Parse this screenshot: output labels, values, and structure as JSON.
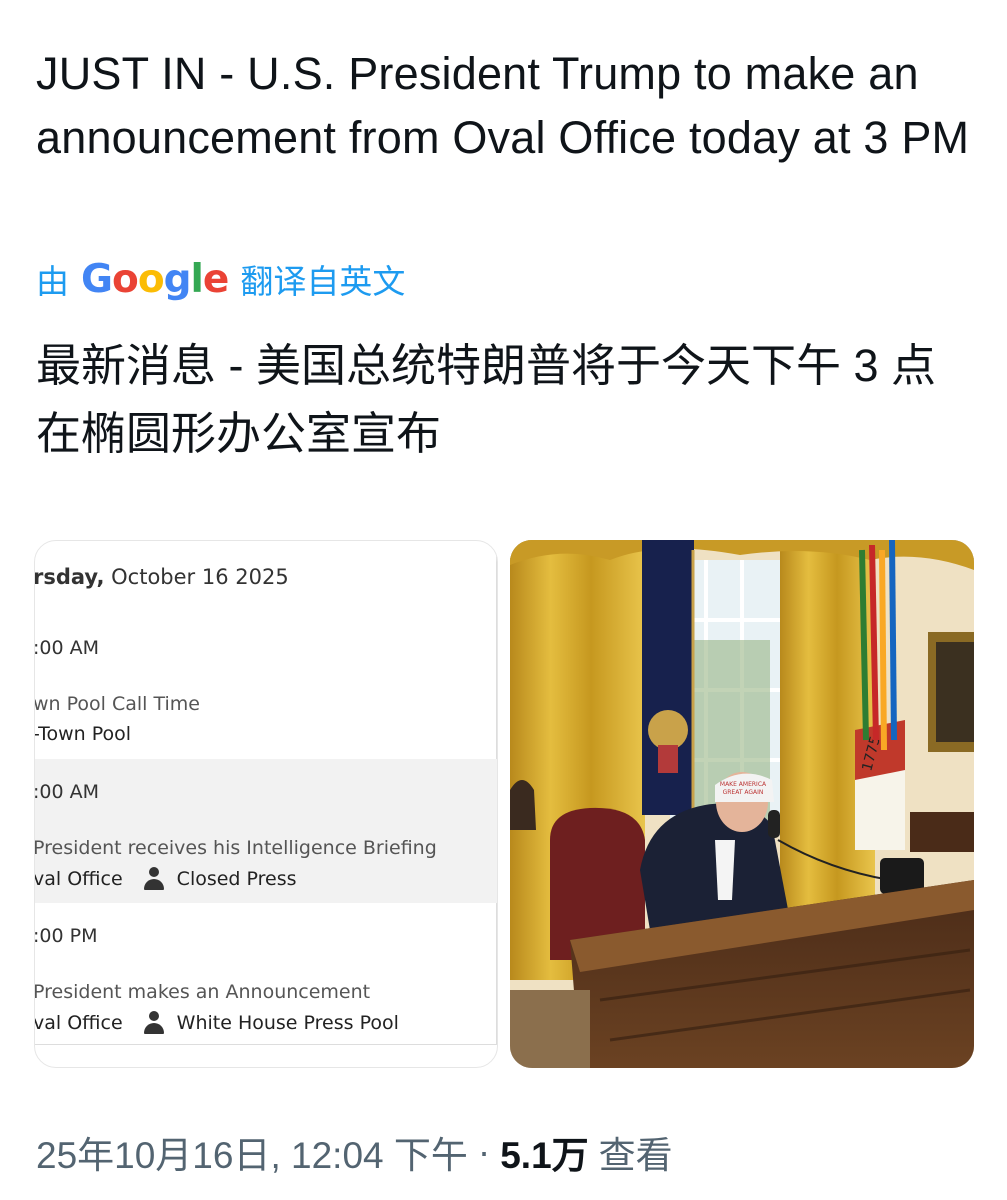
{
  "tweet": {
    "text": "JUST IN - U.S. President Trump to make an announcement from Oval Office today at 3 PM",
    "translate_by": "由",
    "translate_brand": "Google",
    "translate_suffix": "翻译自英文",
    "translated_text": "最新消息 - 美国总统特朗普将于今天下午 3 点在椭圆形办公室宣布"
  },
  "schedule": {
    "day_partial": "rsday,",
    "date": "October 16 2025",
    "entries": [
      {
        "time": ":00 AM",
        "event": "wn Pool Call Time",
        "location": "-Town Pool",
        "press": ""
      },
      {
        "time": ":00 AM",
        "event": "President receives his Intelligence Briefing",
        "location": "val Office",
        "press": "Closed Press"
      },
      {
        "time": ":00 PM",
        "event": "President makes an Announcement",
        "location": "val Office",
        "press": "White House Press Pool"
      }
    ]
  },
  "photo": {
    "cap_text_line1": "MAKE AMERICA",
    "cap_text_line2": "GREAT AGAIN",
    "flag_year": "1775"
  },
  "footer": {
    "datetime": "25年10月16日, 12:04 下午",
    "separator": "·",
    "views": "5.1万",
    "views_label": "查看"
  },
  "colors": {
    "link": "#1d9bf0",
    "text": "#0f1419",
    "muted": "#536471",
    "google_blue": "#4285F4",
    "google_red": "#EA4335",
    "google_yellow": "#FBBC05",
    "google_green": "#34A853"
  }
}
